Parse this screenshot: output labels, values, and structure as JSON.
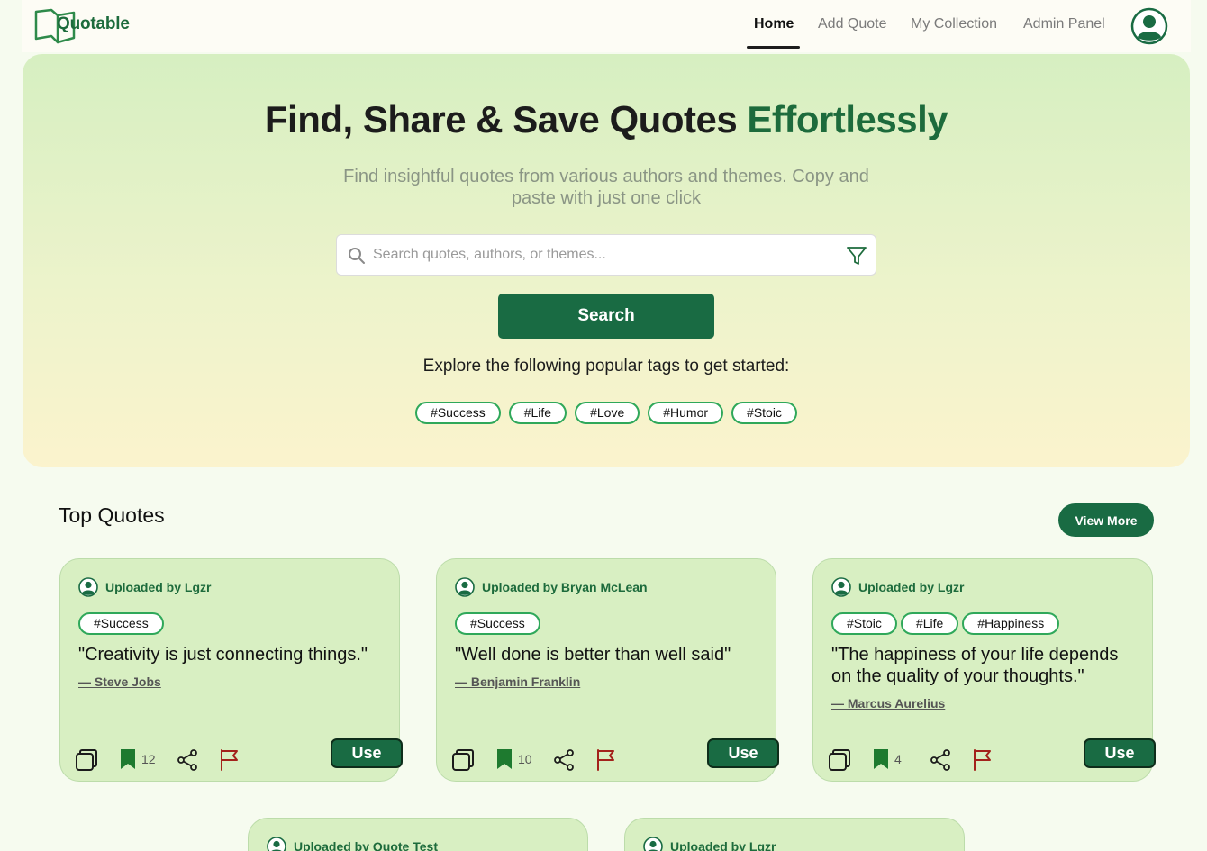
{
  "nav": {
    "logo": "Quotable",
    "links": [
      {
        "label": "Home",
        "active": true
      },
      {
        "label": "Add Quote"
      },
      {
        "label": "My Collection"
      },
      {
        "label": "Admin Panel"
      }
    ],
    "profile_icon": "user-circle-icon"
  },
  "hero": {
    "title_main": "Find, Share & Save Quotes ",
    "title_accent": "Effortlessly",
    "subtitle": "Find insightful quotes from various authors and themes. Copy and paste with just one click",
    "search_placeholder": "Search quotes, authors, or themes...",
    "search_button": "Search",
    "explore_text": "Explore the following popular tags to get started:",
    "tags": [
      "#Success",
      "#Life",
      "#Love",
      "#Humor",
      "#Stoic"
    ]
  },
  "top_quotes": {
    "title": "Top Quotes",
    "view_more": "View More",
    "use_label": "Use",
    "cards": [
      {
        "uploader": "Uploaded by Lgzr",
        "tags": [
          "#Success"
        ],
        "quote": "\"Creativity is just connecting things.\"",
        "author": "— Steve Jobs",
        "saves": "12"
      },
      {
        "uploader": "Uploaded by Bryan McLean",
        "tags": [
          "#Success"
        ],
        "quote": "\"Well done is better than well said\"",
        "author": "— Benjamin Franklin",
        "saves": "10"
      },
      {
        "uploader": "Uploaded by Lgzr",
        "tags": [
          "#Stoic",
          "#Life",
          "#Happiness"
        ],
        "quote": "\"The happiness of your life depends on the quality of your thoughts.\"",
        "author": "— Marcus Aurelius",
        "saves": "4"
      },
      {
        "uploader": "Uploaded by Quote Test"
      },
      {
        "uploader": "Uploaded by Lgzr"
      }
    ]
  },
  "colors": {
    "brand_green": "#196b43",
    "accent_green": "#1d6b3c",
    "tag_border": "#2fa85a",
    "flag_red": "#a3221b"
  },
  "icons": [
    "search-icon",
    "filter-icon",
    "copy-icon",
    "bookmark-icon",
    "share-icon",
    "flag-icon",
    "user-circle-icon"
  ]
}
